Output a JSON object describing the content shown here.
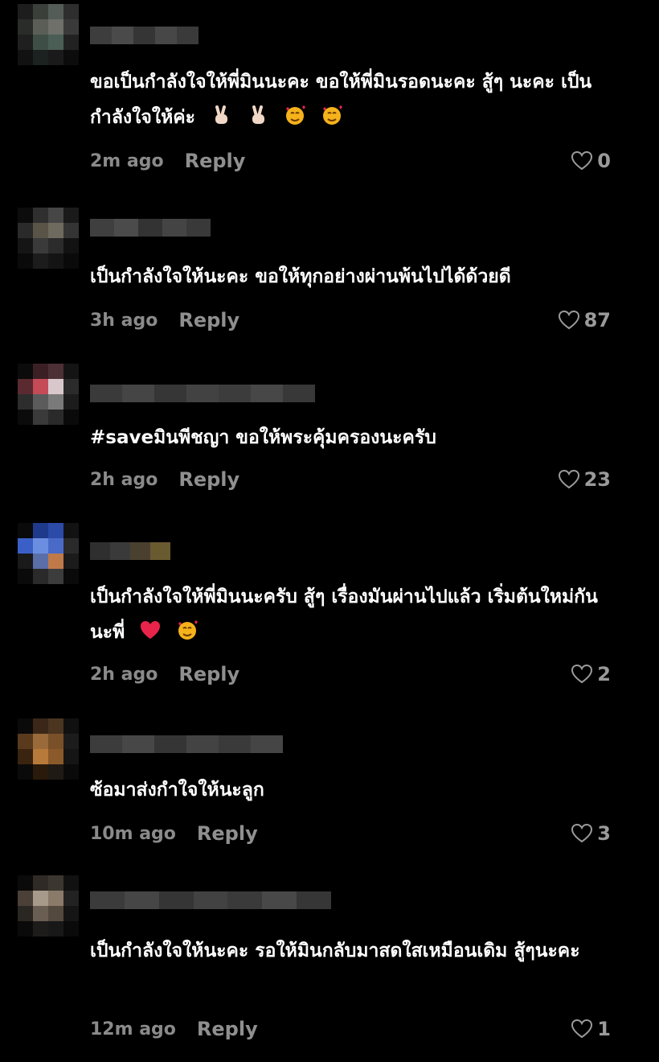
{
  "comments": [
    {
      "text": "ขอเป็นกำลังใจให้พี่มินนะคะ ขอให้พี่มินรอดนะคะ สู้ๆ นะคะ เป็นกำลังใจให้ค่ะ",
      "emojis": [
        "victory-hand-icon",
        "victory-hand-icon",
        "smiling-face-with-hearts-icon",
        "smiling-face-with-hearts-icon"
      ],
      "time": "2m ago",
      "reply": "Reply",
      "likes": "0"
    },
    {
      "text": "เป็นกำลังใจให้นะคะ ขอให้ทุกอย่างผ่านพ้นไปได้ด้วยดี",
      "emojis": [],
      "time": "3h ago",
      "reply": "Reply",
      "likes": "87"
    },
    {
      "text": "#saveมินพีชญา ขอให้พระคุ้มครองนะครับ",
      "emojis": [],
      "time": "2h ago",
      "reply": "Reply",
      "likes": "23"
    },
    {
      "text": "เป็นกำลังใจให้พี่มินนะครับ สู้ๆ เรื่องมันผ่านไปแล้ว เริ่มต้นใหม่กันนะพี่",
      "emojis": [
        "red-heart-icon",
        "smiling-face-with-hearts-icon"
      ],
      "time": "2h ago",
      "reply": "Reply",
      "likes": "2"
    },
    {
      "text": "ซ้อมาส่งกำใจให้นะลูก",
      "emojis": [],
      "time": "10m ago",
      "reply": "Reply",
      "likes": "3"
    },
    {
      "text": "เป็นกำลังใจให้นะคะ รอให้มินกลับมาสดใสเหมือนเดิม สู้ๆนะคะ",
      "emojis": [],
      "time": "12m ago",
      "reply": "Reply",
      "likes": "1"
    }
  ],
  "colors": {
    "background": "#000000",
    "text": "#ffffff",
    "muted": "#8a8a8a",
    "heart_emoji": "#e8244a",
    "face_emoji": "#f5b21b"
  }
}
